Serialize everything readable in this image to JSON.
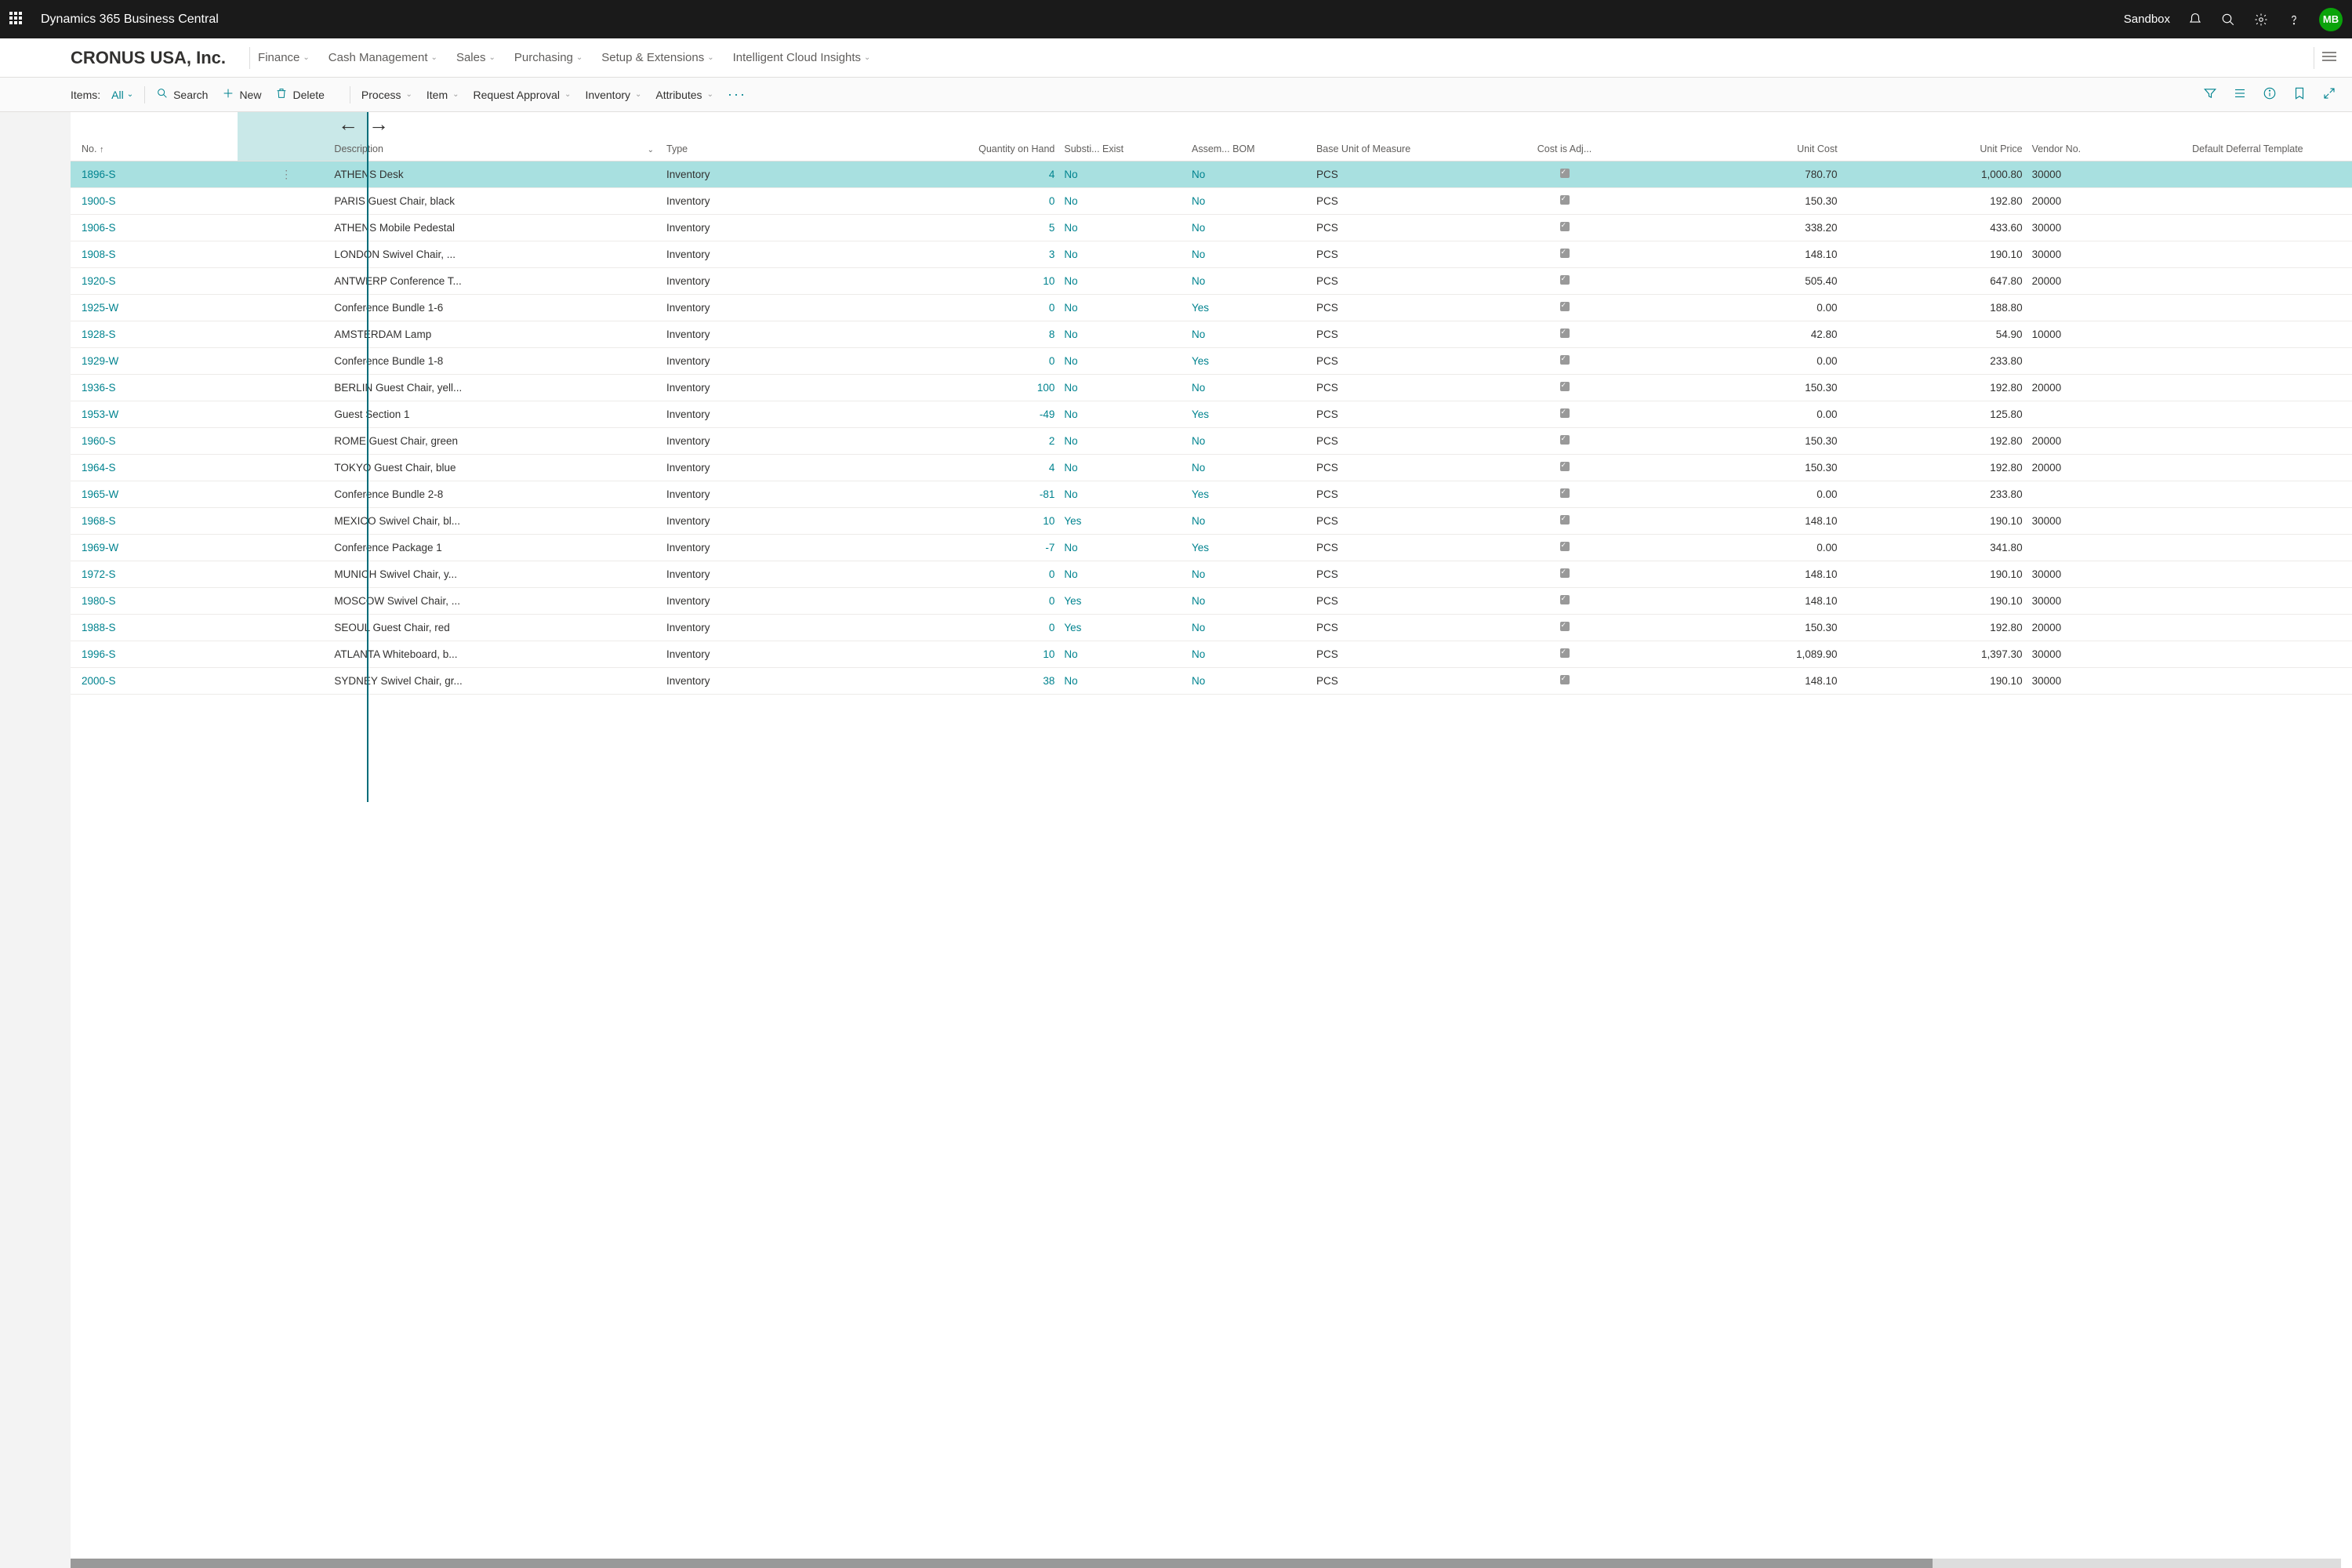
{
  "topbar": {
    "title": "Dynamics 365 Business Central",
    "environment": "Sandbox",
    "avatar_initials": "MB"
  },
  "navbar": {
    "company": "CRONUS USA, Inc.",
    "tabs": [
      "Finance",
      "Cash Management",
      "Sales",
      "Purchasing",
      "Setup & Extensions",
      "Intelligent Cloud Insights"
    ]
  },
  "actionbar": {
    "page_label": "Items:",
    "filter_label": "All",
    "search": "Search",
    "new": "New",
    "delete": "Delete",
    "process": "Process",
    "item": "Item",
    "request_approval": "Request Approval",
    "inventory": "Inventory",
    "attributes": "Attributes"
  },
  "columns": {
    "no": "No.",
    "description": "Description",
    "type": "Type",
    "qty": "Quantity on Hand",
    "substi": "Substi... Exist",
    "assem": "Assem... BOM",
    "uom": "Base Unit of Measure",
    "cost_adj": "Cost is Adj...",
    "unit_cost": "Unit Cost",
    "unit_price": "Unit Price",
    "vendor": "Vendor No.",
    "deferral": "Default Deferral Template"
  },
  "rows": [
    {
      "no": "1896-S",
      "desc": "ATHENS Desk",
      "type": "Inventory",
      "qty": "4",
      "sub": "No",
      "asm": "No",
      "uom": "PCS",
      "uc": "780.70",
      "up": "1,000.80",
      "vendor": "30000",
      "selected": true
    },
    {
      "no": "1900-S",
      "desc": "PARIS Guest Chair, black",
      "type": "Inventory",
      "qty": "0",
      "sub": "No",
      "asm": "No",
      "uom": "PCS",
      "uc": "150.30",
      "up": "192.80",
      "vendor": "20000"
    },
    {
      "no": "1906-S",
      "desc": "ATHENS Mobile Pedestal",
      "type": "Inventory",
      "qty": "5",
      "sub": "No",
      "asm": "No",
      "uom": "PCS",
      "uc": "338.20",
      "up": "433.60",
      "vendor": "30000"
    },
    {
      "no": "1908-S",
      "desc": "LONDON Swivel Chair, ...",
      "type": "Inventory",
      "qty": "3",
      "sub": "No",
      "asm": "No",
      "uom": "PCS",
      "uc": "148.10",
      "up": "190.10",
      "vendor": "30000"
    },
    {
      "no": "1920-S",
      "desc": "ANTWERP Conference T...",
      "type": "Inventory",
      "qty": "10",
      "sub": "No",
      "asm": "No",
      "uom": "PCS",
      "uc": "505.40",
      "up": "647.80",
      "vendor": "20000"
    },
    {
      "no": "1925-W",
      "desc": "Conference Bundle 1-6",
      "type": "Inventory",
      "qty": "0",
      "sub": "No",
      "asm": "Yes",
      "uom": "PCS",
      "uc": "0.00",
      "up": "188.80",
      "vendor": ""
    },
    {
      "no": "1928-S",
      "desc": "AMSTERDAM Lamp",
      "type": "Inventory",
      "qty": "8",
      "sub": "No",
      "asm": "No",
      "uom": "PCS",
      "uc": "42.80",
      "up": "54.90",
      "vendor": "10000"
    },
    {
      "no": "1929-W",
      "desc": "Conference Bundle 1-8",
      "type": "Inventory",
      "qty": "0",
      "sub": "No",
      "asm": "Yes",
      "uom": "PCS",
      "uc": "0.00",
      "up": "233.80",
      "vendor": ""
    },
    {
      "no": "1936-S",
      "desc": "BERLIN Guest Chair, yell...",
      "type": "Inventory",
      "qty": "100",
      "sub": "No",
      "asm": "No",
      "uom": "PCS",
      "uc": "150.30",
      "up": "192.80",
      "vendor": "20000"
    },
    {
      "no": "1953-W",
      "desc": "Guest Section 1",
      "type": "Inventory",
      "qty": "-49",
      "sub": "No",
      "asm": "Yes",
      "uom": "PCS",
      "uc": "0.00",
      "up": "125.80",
      "vendor": ""
    },
    {
      "no": "1960-S",
      "desc": "ROME Guest Chair, green",
      "type": "Inventory",
      "qty": "2",
      "sub": "No",
      "asm": "No",
      "uom": "PCS",
      "uc": "150.30",
      "up": "192.80",
      "vendor": "20000"
    },
    {
      "no": "1964-S",
      "desc": "TOKYO Guest Chair, blue",
      "type": "Inventory",
      "qty": "4",
      "sub": "No",
      "asm": "No",
      "uom": "PCS",
      "uc": "150.30",
      "up": "192.80",
      "vendor": "20000"
    },
    {
      "no": "1965-W",
      "desc": "Conference Bundle 2-8",
      "type": "Inventory",
      "qty": "-81",
      "sub": "No",
      "asm": "Yes",
      "uom": "PCS",
      "uc": "0.00",
      "up": "233.80",
      "vendor": ""
    },
    {
      "no": "1968-S",
      "desc": "MEXICO Swivel Chair, bl...",
      "type": "Inventory",
      "qty": "10",
      "sub": "Yes",
      "asm": "No",
      "uom": "PCS",
      "uc": "148.10",
      "up": "190.10",
      "vendor": "30000"
    },
    {
      "no": "1969-W",
      "desc": "Conference Package 1",
      "type": "Inventory",
      "qty": "-7",
      "sub": "No",
      "asm": "Yes",
      "uom": "PCS",
      "uc": "0.00",
      "up": "341.80",
      "vendor": ""
    },
    {
      "no": "1972-S",
      "desc": "MUNICH Swivel Chair, y...",
      "type": "Inventory",
      "qty": "0",
      "sub": "No",
      "asm": "No",
      "uom": "PCS",
      "uc": "148.10",
      "up": "190.10",
      "vendor": "30000"
    },
    {
      "no": "1980-S",
      "desc": "MOSCOW Swivel Chair, ...",
      "type": "Inventory",
      "qty": "0",
      "sub": "Yes",
      "asm": "No",
      "uom": "PCS",
      "uc": "148.10",
      "up": "190.10",
      "vendor": "30000"
    },
    {
      "no": "1988-S",
      "desc": "SEOUL Guest Chair, red",
      "type": "Inventory",
      "qty": "0",
      "sub": "Yes",
      "asm": "No",
      "uom": "PCS",
      "uc": "150.30",
      "up": "192.80",
      "vendor": "20000"
    },
    {
      "no": "1996-S",
      "desc": "ATLANTA Whiteboard, b...",
      "type": "Inventory",
      "qty": "10",
      "sub": "No",
      "asm": "No",
      "uom": "PCS",
      "uc": "1,089.90",
      "up": "1,397.30",
      "vendor": "30000"
    },
    {
      "no": "2000-S",
      "desc": "SYDNEY Swivel Chair, gr...",
      "type": "Inventory",
      "qty": "38",
      "sub": "No",
      "asm": "No",
      "uom": "PCS",
      "uc": "148.10",
      "up": "190.10",
      "vendor": "30000"
    }
  ]
}
